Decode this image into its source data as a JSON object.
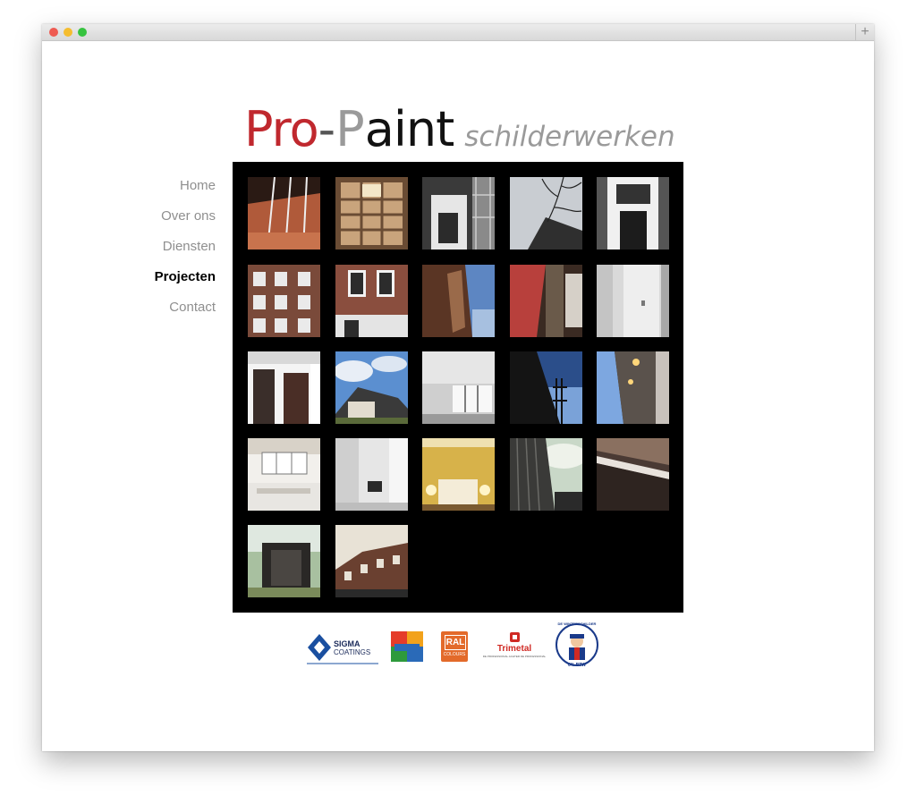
{
  "brand": {
    "pro": "Pro",
    "dash": "-",
    "p": "P",
    "aint": "aint",
    "subtitle": "schilderwerken"
  },
  "nav": {
    "items": [
      {
        "label": "Home"
      },
      {
        "label": "Over ons"
      },
      {
        "label": "Diensten"
      },
      {
        "label": "Projecten",
        "active": true
      },
      {
        "label": "Contact"
      }
    ]
  },
  "colors": {
    "brand_red": "#c0282e",
    "brand_gray": "#9a9a9a",
    "gallery_bg": "#000000"
  },
  "partners": {
    "sigma_line1": "SIGMA",
    "sigma_line2": "COATINGS",
    "ral_line1": "RAL",
    "ral_line2": "COLOURS",
    "trimetal": "Trimetal",
    "trimetal_tagline": "DE PROFESSIONAL ACHTER DE PROFESSIONAL",
    "winter_top": "DE WINTERSCHILDER",
    "winter_bottom": "6% BTW"
  }
}
